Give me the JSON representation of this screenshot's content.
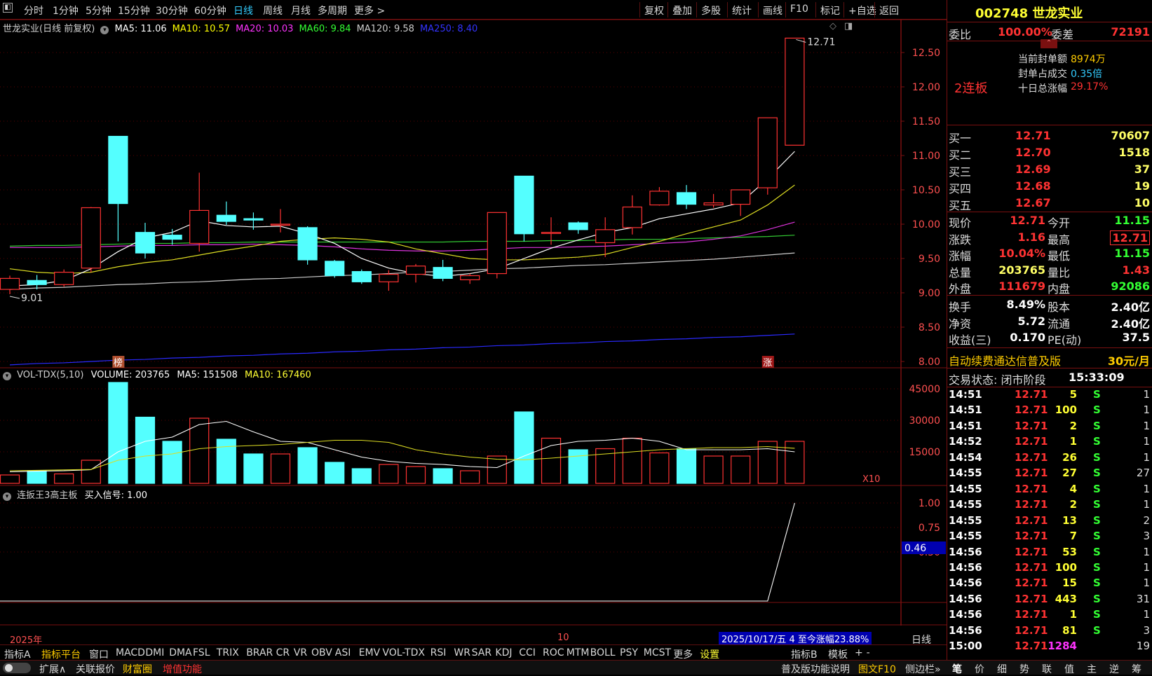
{
  "toolbar": {
    "periods": [
      "分时",
      "1分钟",
      "5分钟",
      "15分钟",
      "30分钟",
      "60分钟",
      "日线",
      "周线",
      "月线",
      "多周期",
      "更多 >"
    ],
    "active_period": "日线",
    "right_buttons": [
      "复权",
      "叠加",
      "多股",
      "统计",
      "画线",
      "F10",
      "标记",
      "+自选",
      "返回"
    ]
  },
  "main_panel": {
    "title": "世龙实业(日线 前复权)",
    "ma_labels": [
      {
        "text": "MA5: 11.06",
        "color": "#ffffff"
      },
      {
        "text": "MA10: 10.57",
        "color": "#ffff00"
      },
      {
        "text": "MA20: 10.03",
        "color": "#ff33ff"
      },
      {
        "text": "MA60: 9.84",
        "color": "#33ff33"
      },
      {
        "text": "MA120: 9.58",
        "color": "#cccccc"
      },
      {
        "text": "MA250: 8.40",
        "color": "#3333ff"
      }
    ],
    "y_ticks": [
      "12.50",
      "12.00",
      "11.50",
      "11.00",
      "10.50",
      "10.00",
      "9.50",
      "9.00",
      "8.50",
      "8.00"
    ],
    "high_label": "12.71",
    "low_label": "9.01",
    "markers": [
      "榜",
      "涨"
    ]
  },
  "candles": [
    {
      "o": 9.05,
      "c": 9.21,
      "h": 9.25,
      "l": 8.98
    },
    {
      "o": 9.18,
      "c": 9.12,
      "h": 9.26,
      "l": 9.05
    },
    {
      "o": 9.12,
      "c": 9.3,
      "h": 9.34,
      "l": 9.09
    },
    {
      "o": 9.36,
      "c": 10.24,
      "h": 10.25,
      "l": 9.3
    },
    {
      "o": 11.28,
      "c": 10.3,
      "h": 11.28,
      "l": 9.75
    },
    {
      "o": 9.88,
      "c": 9.58,
      "h": 10.02,
      "l": 9.5
    },
    {
      "o": 9.84,
      "c": 9.78,
      "h": 9.93,
      "l": 9.7
    },
    {
      "o": 9.72,
      "c": 10.2,
      "h": 10.75,
      "l": 9.6
    },
    {
      "o": 10.13,
      "c": 10.04,
      "h": 10.33,
      "l": 9.99
    },
    {
      "o": 10.08,
      "c": 10.06,
      "h": 10.17,
      "l": 9.92
    },
    {
      "o": 10.0,
      "c": 10.0,
      "h": 10.22,
      "l": 9.88
    },
    {
      "o": 9.95,
      "c": 9.48,
      "h": 9.97,
      "l": 9.41
    },
    {
      "o": 9.46,
      "c": 9.25,
      "h": 9.48,
      "l": 9.22
    },
    {
      "o": 9.31,
      "c": 9.16,
      "h": 9.34,
      "l": 9.13
    },
    {
      "o": 9.16,
      "c": 9.27,
      "h": 9.33,
      "l": 9.03
    },
    {
      "o": 9.27,
      "c": 9.39,
      "h": 9.42,
      "l": 9.15
    },
    {
      "o": 9.37,
      "c": 9.21,
      "h": 9.48,
      "l": 9.17
    },
    {
      "o": 9.19,
      "c": 9.25,
      "h": 9.28,
      "l": 9.13
    },
    {
      "o": 9.28,
      "c": 10.17,
      "h": 10.17,
      "l": 9.21
    },
    {
      "o": 10.7,
      "c": 9.86,
      "h": 10.7,
      "l": 9.75
    },
    {
      "o": 9.88,
      "c": 9.88,
      "h": 10.1,
      "l": 9.7
    },
    {
      "o": 10.02,
      "c": 9.92,
      "h": 10.04,
      "l": 9.86
    },
    {
      "o": 9.73,
      "c": 9.92,
      "h": 10.1,
      "l": 9.52
    },
    {
      "o": 9.95,
      "c": 10.25,
      "h": 10.42,
      "l": 9.85
    },
    {
      "o": 10.28,
      "c": 10.48,
      "h": 10.54,
      "l": 10.27
    },
    {
      "o": 10.46,
      "c": 10.29,
      "h": 10.57,
      "l": 10.22
    },
    {
      "o": 10.28,
      "c": 10.31,
      "h": 10.44,
      "l": 10.24
    },
    {
      "o": 10.29,
      "c": 10.5,
      "h": 10.5,
      "l": 10.12
    },
    {
      "o": 10.53,
      "c": 11.55,
      "h": 11.55,
      "l": 10.43
    },
    {
      "o": 11.15,
      "c": 12.71,
      "h": 12.71,
      "l": 11.15
    }
  ],
  "ma_series": {
    "ma5": [
      9.1,
      9.12,
      9.18,
      9.35,
      9.6,
      9.8,
      9.88,
      10.05,
      9.98,
      9.96,
      9.97,
      9.86,
      9.72,
      9.5,
      9.36,
      9.28,
      9.24,
      9.28,
      9.35,
      9.5,
      9.65,
      9.77,
      9.88,
      9.95,
      10.08,
      10.15,
      10.22,
      10.31,
      10.66,
      11.06
    ],
    "ma10": [
      9.35,
      9.3,
      9.28,
      9.3,
      9.38,
      9.44,
      9.48,
      9.55,
      9.62,
      9.68,
      9.75,
      9.78,
      9.8,
      9.78,
      9.74,
      9.64,
      9.57,
      9.5,
      9.48,
      9.48,
      9.5,
      9.52,
      9.56,
      9.66,
      9.75,
      9.86,
      9.96,
      10.06,
      10.28,
      10.57
    ],
    "ma20": [
      9.66,
      9.66,
      9.66,
      9.67,
      9.68,
      9.69,
      9.69,
      9.7,
      9.7,
      9.71,
      9.7,
      9.69,
      9.67,
      9.64,
      9.62,
      9.61,
      9.61,
      9.62,
      9.64,
      9.66,
      9.66,
      9.67,
      9.68,
      9.7,
      9.72,
      9.74,
      9.78,
      9.83,
      9.92,
      10.03
    ],
    "ma60": [
      9.68,
      9.69,
      9.69,
      9.7,
      9.71,
      9.72,
      9.72,
      9.73,
      9.73,
      9.74,
      9.74,
      9.74,
      9.74,
      9.74,
      9.74,
      9.74,
      9.74,
      9.75,
      9.75,
      9.75,
      9.76,
      9.76,
      9.77,
      9.78,
      9.78,
      9.79,
      9.8,
      9.81,
      9.82,
      9.84
    ],
    "ma120": [
      9.05,
      9.07,
      9.08,
      9.1,
      9.12,
      9.13,
      9.15,
      9.16,
      9.18,
      9.2,
      9.21,
      9.23,
      9.25,
      9.26,
      9.28,
      9.3,
      9.31,
      9.33,
      9.35,
      9.36,
      9.38,
      9.4,
      9.41,
      9.43,
      9.45,
      9.47,
      9.49,
      9.52,
      9.55,
      9.58
    ],
    "ma250": [
      7.95,
      7.97,
      7.98,
      8.0,
      8.02,
      8.03,
      8.05,
      8.06,
      8.08,
      8.09,
      8.11,
      8.12,
      8.14,
      8.15,
      8.17,
      8.18,
      8.2,
      8.21,
      8.23,
      8.24,
      8.26,
      8.27,
      8.29,
      8.3,
      8.32,
      8.33,
      8.35,
      8.36,
      8.38,
      8.4
    ]
  },
  "volume_panel": {
    "title": "VOL-TDX(5,10)",
    "volume_label": "VOLUME: 203765",
    "ma5_label": "MA5: 151508",
    "ma10_label": "MA10: 167460",
    "y_ticks": [
      "45000",
      "30000",
      "15000"
    ],
    "unit": "X10",
    "volumes": [
      40,
      60,
      45,
      110,
      480,
      315,
      200,
      310,
      210,
      140,
      140,
      170,
      100,
      70,
      90,
      80,
      70,
      60,
      130,
      340,
      215,
      160,
      165,
      215,
      145,
      165,
      130,
      130,
      200,
      200
    ],
    "vol_ma5": [
      55,
      58,
      60,
      65,
      150,
      200,
      220,
      280,
      295,
      245,
      200,
      195,
      160,
      125,
      105,
      95,
      90,
      80,
      75,
      130,
      180,
      200,
      205,
      215,
      200,
      160,
      160,
      160,
      165,
      150
    ],
    "vol_ma10": [
      60,
      62,
      64,
      66,
      110,
      130,
      140,
      165,
      175,
      180,
      185,
      195,
      205,
      205,
      195,
      160,
      140,
      125,
      115,
      112,
      120,
      130,
      140,
      150,
      160,
      165,
      170,
      170,
      175,
      167
    ]
  },
  "indicator_panel": {
    "title": "连扳王3高主板",
    "signal_label": "买入信号: 1.00",
    "y_ticks": [
      "1.00",
      "0.75",
      "0.50"
    ],
    "current": "0.46",
    "values": [
      0,
      0,
      0,
      0,
      0,
      0,
      0,
      0,
      0,
      0,
      0,
      0,
      0,
      0,
      0,
      0,
      0,
      0,
      0,
      0,
      0,
      0,
      0,
      0,
      0,
      0,
      0,
      0,
      0,
      1.0
    ]
  },
  "date_axis": {
    "year_label": "2025年",
    "month_label": "10",
    "status": "2025/10/17/五 4 至今涨幅23.88%",
    "period_tag": "日线"
  },
  "indicator_tabs": [
    "指标A",
    "指标平台",
    "窗口",
    "MACD",
    "DMI",
    "DMA",
    "FSL",
    "TRIX",
    "BRAR",
    "CR",
    "VR",
    "OBV",
    "ASI",
    "EMV",
    "VOL-TDX",
    "RSI",
    "WR",
    "SAR",
    "KDJ",
    "CCI",
    "ROC",
    "MTM",
    "BOLL",
    "PSY",
    "MCST",
    "更多",
    "设置",
    "指标B",
    "模板",
    "+",
    "-"
  ],
  "status_bar": {
    "left_items": [
      "扩展∧",
      "关联报价",
      "财富圈",
      "增值功能"
    ],
    "right_items": [
      "普及版功能说明",
      "图文F10",
      "侧边栏»"
    ],
    "panel_tabs": [
      "笔",
      "价",
      "细",
      "势",
      "联",
      "值",
      "主",
      "逆",
      "筹"
    ]
  },
  "quote": {
    "code_name": "002748 世龙实业",
    "weibi_label": "委比",
    "weibi_value": "100.00%",
    "weicha_label": "委差",
    "weicha_value": "72191",
    "streak": "2连板",
    "seal_info": [
      {
        "label": "当前封单额",
        "value": "8974万"
      },
      {
        "label": "封单占成交",
        "value": "0.35倍"
      },
      {
        "label": "十日总涨幅",
        "value": "29.17%"
      }
    ],
    "bids": [
      {
        "label": "买一",
        "price": "12.71",
        "vol": "70607"
      },
      {
        "label": "买二",
        "price": "12.70",
        "vol": "1518"
      },
      {
        "label": "买三",
        "price": "12.69",
        "vol": "37"
      },
      {
        "label": "买四",
        "price": "12.68",
        "vol": "19"
      },
      {
        "label": "买五",
        "price": "12.67",
        "vol": "10"
      }
    ],
    "stats": [
      {
        "l1": "现价",
        "v1": "12.71",
        "c1": "#ff3333",
        "l2": "今开",
        "v2": "11.15",
        "c2": "#33ff33"
      },
      {
        "l1": "涨跌",
        "v1": "1.16",
        "c1": "#ff3333",
        "l2": "最高",
        "v2": "12.71",
        "c2": "#ff3333"
      },
      {
        "l1": "涨幅",
        "v1": "10.04%",
        "c1": "#ff3333",
        "l2": "最低",
        "v2": "11.15",
        "c2": "#33ff33"
      },
      {
        "l1": "总量",
        "v1": "203765",
        "c1": "#ffff66",
        "l2": "量比",
        "v2": "1.43",
        "c2": "#ff3333"
      },
      {
        "l1": "外盘",
        "v1": "111679",
        "c1": "#ff3333",
        "l2": "内盘",
        "v2": "92086",
        "c2": "#33ff33"
      }
    ],
    "stats2": [
      {
        "l1": "换手",
        "v1": "8.49%",
        "l2": "股本",
        "v2": "2.40亿"
      },
      {
        "l1": "净资",
        "v1": "5.72",
        "l2": "流通",
        "v2": "2.40亿"
      },
      {
        "l1": "收益(三)",
        "v1": "0.170",
        "l2": "PE(动)",
        "v2": "37.5"
      }
    ],
    "promo_text": "自动续费通达信普及版",
    "promo_price": "30元/月",
    "trade_status": "交易状态: 闭市阶段",
    "trade_time": "15:33:09"
  },
  "ticks": [
    {
      "t": "14:51",
      "p": "12.71",
      "v": "5",
      "bs": "S",
      "n": "1"
    },
    {
      "t": "14:51",
      "p": "12.71",
      "v": "100",
      "bs": "S",
      "n": "1"
    },
    {
      "t": "14:51",
      "p": "12.71",
      "v": "2",
      "bs": "S",
      "n": "1"
    },
    {
      "t": "14:52",
      "p": "12.71",
      "v": "1",
      "bs": "S",
      "n": "1"
    },
    {
      "t": "14:54",
      "p": "12.71",
      "v": "26",
      "bs": "S",
      "n": "1"
    },
    {
      "t": "14:55",
      "p": "12.71",
      "v": "27",
      "bs": "S",
      "n": "27"
    },
    {
      "t": "14:55",
      "p": "12.71",
      "v": "4",
      "bs": "S",
      "n": "1"
    },
    {
      "t": "14:55",
      "p": "12.71",
      "v": "2",
      "bs": "S",
      "n": "1"
    },
    {
      "t": "14:55",
      "p": "12.71",
      "v": "13",
      "bs": "S",
      "n": "2"
    },
    {
      "t": "14:55",
      "p": "12.71",
      "v": "7",
      "bs": "S",
      "n": "3"
    },
    {
      "t": "14:56",
      "p": "12.71",
      "v": "53",
      "bs": "S",
      "n": "1"
    },
    {
      "t": "14:56",
      "p": "12.71",
      "v": "100",
      "bs": "S",
      "n": "1"
    },
    {
      "t": "14:56",
      "p": "12.71",
      "v": "15",
      "bs": "S",
      "n": "1"
    },
    {
      "t": "14:56",
      "p": "12.71",
      "v": "443",
      "bs": "S",
      "n": "31"
    },
    {
      "t": "14:56",
      "p": "12.71",
      "v": "1",
      "bs": "S",
      "n": "1"
    },
    {
      "t": "14:56",
      "p": "12.71",
      "v": "81",
      "bs": "S",
      "n": "3"
    },
    {
      "t": "15:00",
      "p": "12.71",
      "v": "1284",
      "bs": "",
      "n": "19"
    }
  ],
  "colors": {
    "up": "#ff3232",
    "down": "#54ffff",
    "border": "#7a1010",
    "grid": "#5a0000",
    "axis_text": "#ff5050"
  }
}
